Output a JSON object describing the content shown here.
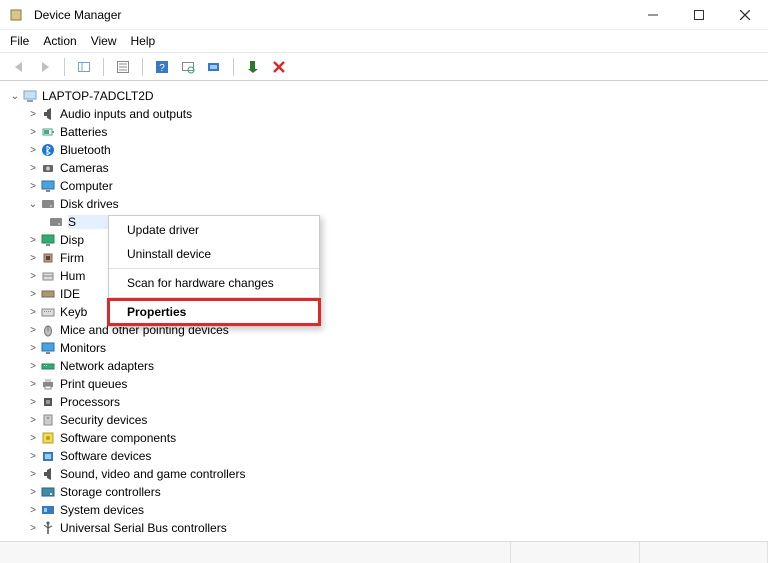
{
  "titlebar": {
    "title": "Device Manager"
  },
  "menubar": {
    "file": "File",
    "action": "Action",
    "view": "View",
    "help": "Help"
  },
  "tree": {
    "root": "LAPTOP-7ADCLT2D",
    "disk_child_label": "S",
    "items": [
      {
        "label": "Audio inputs and outputs",
        "icon": "speaker"
      },
      {
        "label": "Batteries",
        "icon": "battery"
      },
      {
        "label": "Bluetooth",
        "icon": "bluetooth"
      },
      {
        "label": "Cameras",
        "icon": "camera"
      },
      {
        "label": "Computer",
        "icon": "monitor"
      },
      {
        "label": "Disk drives",
        "icon": "disk",
        "expanded": true
      },
      {
        "label": "Disp",
        "icon": "display"
      },
      {
        "label": "Firm",
        "icon": "chip"
      },
      {
        "label": "Hum",
        "icon": "hid"
      },
      {
        "label": "IDE",
        "icon": "ide"
      },
      {
        "label": "Keyb",
        "icon": "keyboard"
      },
      {
        "label": "Mice and other pointing devices",
        "icon": "mouse"
      },
      {
        "label": "Monitors",
        "icon": "monitor2"
      },
      {
        "label": "Network adapters",
        "icon": "network"
      },
      {
        "label": "Print queues",
        "icon": "printer"
      },
      {
        "label": "Processors",
        "icon": "cpu"
      },
      {
        "label": "Security devices",
        "icon": "security"
      },
      {
        "label": "Software components",
        "icon": "swcomp"
      },
      {
        "label": "Software devices",
        "icon": "swdev"
      },
      {
        "label": "Sound, video and game controllers",
        "icon": "sound"
      },
      {
        "label": "Storage controllers",
        "icon": "storage"
      },
      {
        "label": "System devices",
        "icon": "system"
      },
      {
        "label": "Universal Serial Bus controllers",
        "icon": "usb"
      }
    ]
  },
  "context_menu": {
    "update": "Update driver",
    "uninstall": "Uninstall device",
    "scan": "Scan for hardware changes",
    "properties": "Properties"
  }
}
